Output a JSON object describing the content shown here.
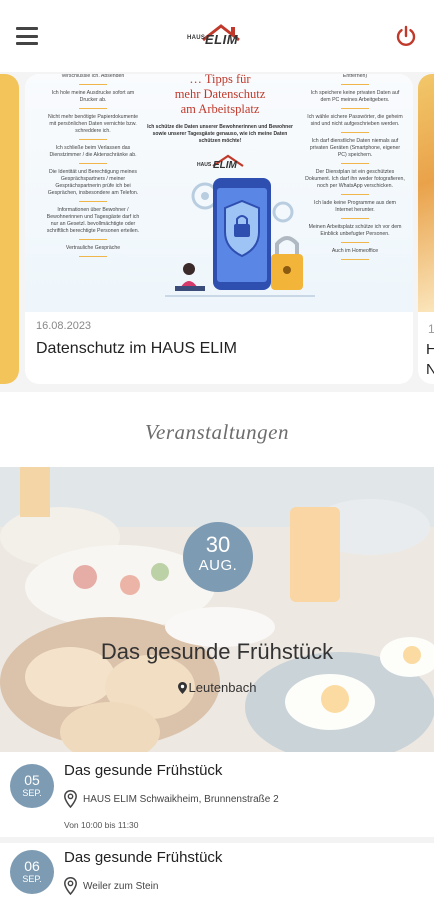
{
  "header": {
    "logo_haus": "HAUS",
    "logo_elim": "ELIM",
    "menu_icon": "hamburger-menu-icon",
    "power_icon": "power-icon",
    "accent_color": "#c0392b"
  },
  "news": {
    "cards": [
      {
        "date": "16.08.2023",
        "title": "Datenschutz im HAUS ELIM",
        "poster": {
          "heading_line1": "… Tipps für",
          "heading_line2": "mehr Datenschutz",
          "heading_line3": "am Arbeitsplatz",
          "subtitle": "Ich schütze die Daten unserer Bewohnerinnen und Bewohner sowie unserer Tagesgäste genauso, wie ich meine Daten schützen möchte!",
          "logo_haus": "HAUS",
          "logo_elim": "ELIM",
          "left_col": [
            "Dateien (auch keine Word-Dokumente) verschlüssle ich. Absenden",
            "Ich hole meine Ausdrucke sofort am Drucker ab.",
            "Nicht mehr benötigte Papierdokumente mit persönlichen Daten vernichte bzw. schreddere ich.",
            "Ich schließe beim Verlassen das Dienstzimmer / die Aktenschränke ab.",
            "Die Identität und Berechtigung meines Gesprächspartners / meiner Gesprächspartnerin prüfe ich bei Gesprächen, insbesondere am Telefon.",
            "Informationen über Bewohner / Bewohnerinnen und Tagesgäste darf ich nur an Gesetzl. bevollmächtigte oder schriftlich berechtigte Personen erteilen.",
            "Vertrauliche Gespräche"
          ],
          "right_col": [
            "bei meiner Abwesenheit (Strg + Alt + Entfernen)",
            "Ich speichere keine privaten Daten auf dem PC meines Arbeitgebers.",
            "Ich wähle sichere Passwörter, die geheim sind und nicht aufgeschrieben werden.",
            "Ich darf dienstliche Daten niemals auf privaten Geräten (Smartphone, eigener PC) speichern.",
            "Der Dienstplan ist ein geschütztes Dokument. Ich darf ihn weder fotografieren, noch per WhatsApp verschicken.",
            "Ich lade keine Programme aus dem Internet herunter.",
            "Meinen Arbeitsplatz schütze ich vor dem Einblick unbefugter Personen.",
            "Auch im Homeoffice"
          ]
        }
      }
    ],
    "right_peek_date": "1",
    "right_peek_line1": "H",
    "right_peek_line2": "N"
  },
  "events": {
    "section_title": "Veranstaltungen",
    "featured": {
      "day": "30",
      "month": "AUG.",
      "title": "Das gesunde Frühstück",
      "location": "Leutenbach",
      "location_icon": "map-pin-icon"
    },
    "list": [
      {
        "day": "05",
        "month": "SEP.",
        "title": "Das gesunde Frühstück",
        "location": "HAUS ELIM Schwaikheim, Brunnenstraße 2",
        "time": "Von 10:00 bis 11:30"
      },
      {
        "day": "06",
        "month": "SEP.",
        "title": "Das gesunde Frühstück",
        "location": "Weiler zum Stein",
        "time": ""
      }
    ],
    "date_badge_color": "#7d9bb3"
  }
}
